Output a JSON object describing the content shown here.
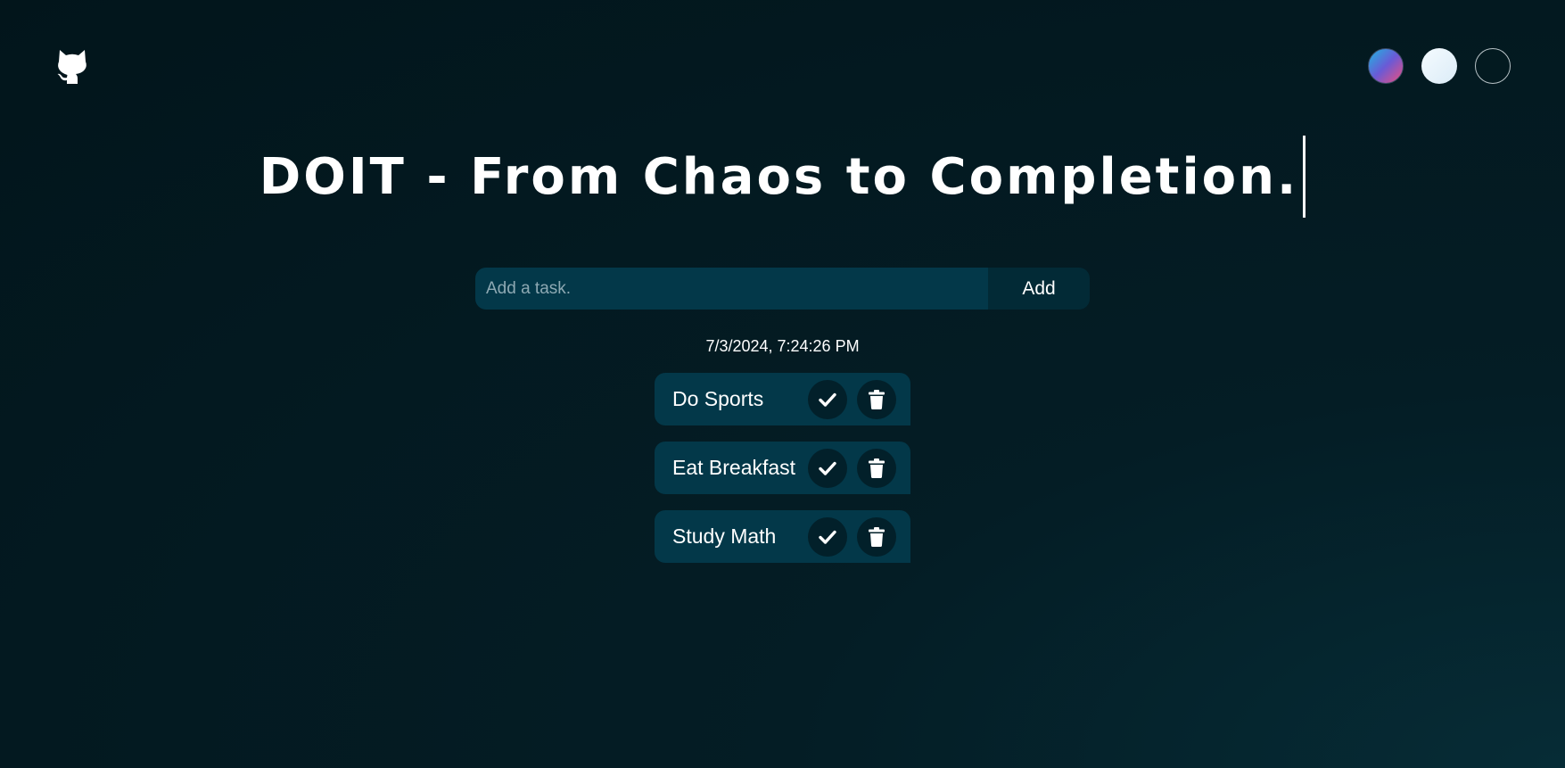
{
  "header": {
    "github_icon": "github-icon",
    "themes": [
      {
        "name": "gradient-theme",
        "colors": [
          "#1fb6e0",
          "#ee4f7c"
        ]
      },
      {
        "name": "light-theme",
        "color": "#f5fbff"
      },
      {
        "name": "dark-theme",
        "color": "#031a20"
      }
    ]
  },
  "title": "DOIT - From Chaos to Completion.",
  "form": {
    "placeholder": "Add a task.",
    "value": "",
    "add_label": "Add"
  },
  "datetime": "7/3/2024, 7:24:26 PM",
  "tasks": [
    {
      "label": "Do Sports"
    },
    {
      "label": "Eat Breakfast"
    },
    {
      "label": "Study Math"
    }
  ],
  "colors": {
    "background": "#031920",
    "surface": "#033849",
    "button": "#022a36",
    "icon_bg": "#02202a"
  }
}
